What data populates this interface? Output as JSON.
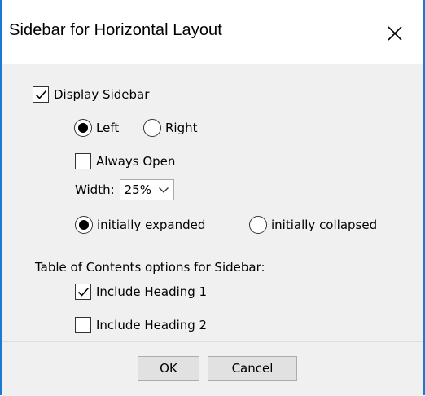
{
  "dialog": {
    "title": "Sidebar for Horizontal Layout",
    "close_icon": "close-icon"
  },
  "display_sidebar": {
    "label": "Display Sidebar",
    "checked": true
  },
  "position": {
    "options": [
      {
        "label": "Left",
        "selected": true
      },
      {
        "label": "Right",
        "selected": false
      }
    ]
  },
  "always_open": {
    "label": "Always Open",
    "checked": false
  },
  "width": {
    "label": "Width:",
    "value": "25%"
  },
  "initial_state": {
    "options": [
      {
        "label": "initially expanded",
        "selected": true
      },
      {
        "label": "initially collapsed",
        "selected": false
      }
    ]
  },
  "toc": {
    "heading": "Table of Contents options for Sidebar:",
    "items": [
      {
        "label": "Include Heading 1",
        "checked": true
      },
      {
        "label": "Include Heading 2",
        "checked": false
      }
    ]
  },
  "buttons": {
    "ok": "OK",
    "cancel": "Cancel"
  },
  "colors": {
    "window_border": "#1e78d2",
    "dialog_bg": "#f0f0f0",
    "button_bg": "#e1e1e1"
  }
}
